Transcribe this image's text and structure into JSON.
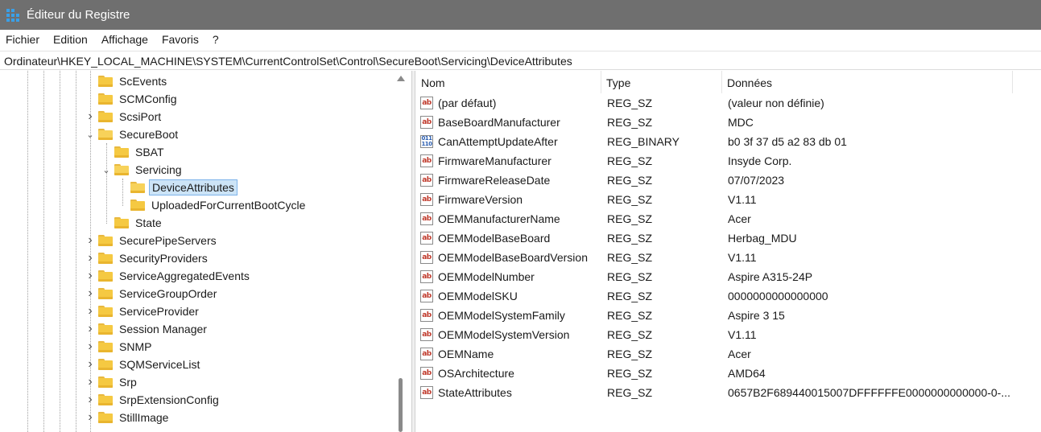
{
  "window": {
    "title": "Éditeur du Registre"
  },
  "menu": [
    "Fichier",
    "Edition",
    "Affichage",
    "Favoris",
    "?"
  ],
  "address": "Ordinateur\\HKEY_LOCAL_MACHINE\\SYSTEM\\CurrentControlSet\\Control\\SecureBoot\\Servicing\\DeviceAttributes",
  "tree": {
    "items": [
      {
        "label": "ScEvents",
        "level": 0,
        "chevron": ""
      },
      {
        "label": "SCMConfig",
        "level": 0,
        "chevron": ""
      },
      {
        "label": "ScsiPort",
        "level": 0,
        "chevron": "right"
      },
      {
        "label": "SecureBoot",
        "level": 0,
        "chevron": "down"
      },
      {
        "label": "SBAT",
        "level": 1,
        "chevron": ""
      },
      {
        "label": "Servicing",
        "level": 1,
        "chevron": "down"
      },
      {
        "label": "DeviceAttributes",
        "level": 2,
        "chevron": "",
        "selected": true
      },
      {
        "label": "UploadedForCurrentBootCycle",
        "level": 2,
        "chevron": ""
      },
      {
        "label": "State",
        "level": 1,
        "chevron": ""
      },
      {
        "label": "SecurePipeServers",
        "level": 0,
        "chevron": "right"
      },
      {
        "label": "SecurityProviders",
        "level": 0,
        "chevron": "right"
      },
      {
        "label": "ServiceAggregatedEvents",
        "level": 0,
        "chevron": "right"
      },
      {
        "label": "ServiceGroupOrder",
        "level": 0,
        "chevron": "right"
      },
      {
        "label": "ServiceProvider",
        "level": 0,
        "chevron": "right"
      },
      {
        "label": "Session Manager",
        "level": 0,
        "chevron": "right"
      },
      {
        "label": "SNMP",
        "level": 0,
        "chevron": "right"
      },
      {
        "label": "SQMServiceList",
        "level": 0,
        "chevron": "right"
      },
      {
        "label": "Srp",
        "level": 0,
        "chevron": "right"
      },
      {
        "label": "SrpExtensionConfig",
        "level": 0,
        "chevron": "right"
      },
      {
        "label": "StillImage",
        "level": 0,
        "chevron": "right"
      }
    ]
  },
  "list": {
    "headers": {
      "name": "Nom",
      "type": "Type",
      "data": "Données"
    },
    "rows": [
      {
        "icon": "string",
        "name": "(par défaut)",
        "type": "REG_SZ",
        "data": "(valeur non définie)"
      },
      {
        "icon": "string",
        "name": "BaseBoardManufacturer",
        "type": "REG_SZ",
        "data": "MDC"
      },
      {
        "icon": "binary",
        "name": "CanAttemptUpdateAfter",
        "type": "REG_BINARY",
        "data": "b0 3f 37 d5 a2 83 db 01"
      },
      {
        "icon": "string",
        "name": "FirmwareManufacturer",
        "type": "REG_SZ",
        "data": "Insyde Corp."
      },
      {
        "icon": "string",
        "name": "FirmwareReleaseDate",
        "type": "REG_SZ",
        "data": "07/07/2023"
      },
      {
        "icon": "string",
        "name": "FirmwareVersion",
        "type": "REG_SZ",
        "data": "V1.11"
      },
      {
        "icon": "string",
        "name": "OEMManufacturerName",
        "type": "REG_SZ",
        "data": "Acer"
      },
      {
        "icon": "string",
        "name": "OEMModelBaseBoard",
        "type": "REG_SZ",
        "data": "Herbag_MDU"
      },
      {
        "icon": "string",
        "name": "OEMModelBaseBoardVersion",
        "type": "REG_SZ",
        "data": "V1.11"
      },
      {
        "icon": "string",
        "name": "OEMModelNumber",
        "type": "REG_SZ",
        "data": "Aspire A315-24P"
      },
      {
        "icon": "string",
        "name": "OEMModelSKU",
        "type": "REG_SZ",
        "data": "0000000000000000"
      },
      {
        "icon": "string",
        "name": "OEMModelSystemFamily",
        "type": "REG_SZ",
        "data": "Aspire 3 15"
      },
      {
        "icon": "string",
        "name": "OEMModelSystemVersion",
        "type": "REG_SZ",
        "data": "V1.11"
      },
      {
        "icon": "string",
        "name": "OEMName",
        "type": "REG_SZ",
        "data": "Acer"
      },
      {
        "icon": "string",
        "name": "OSArchitecture",
        "type": "REG_SZ",
        "data": "AMD64"
      },
      {
        "icon": "string",
        "name": "StateAttributes",
        "type": "REG_SZ",
        "data": "0657B2F689440015007DFFFFFFE0000000000000-0-..."
      }
    ]
  },
  "colors": {
    "titlebar": "#6f6f6f",
    "selection": "#cce4f7",
    "folder": "#f5c942"
  }
}
